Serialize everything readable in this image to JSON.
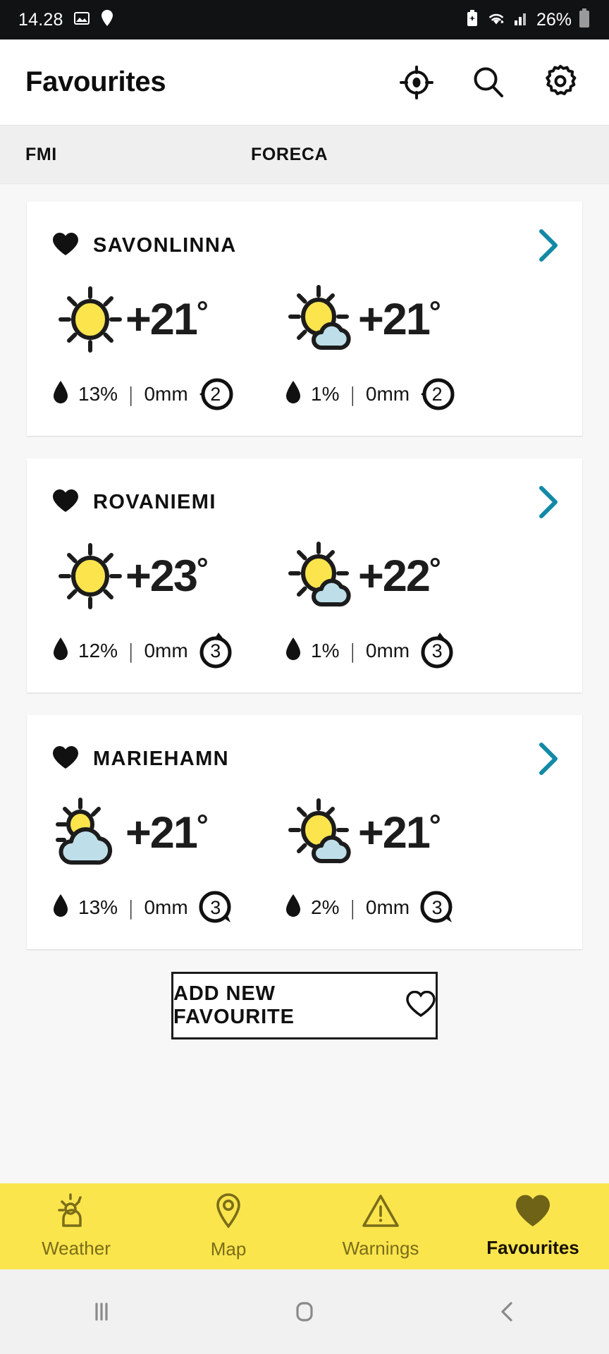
{
  "status_bar": {
    "time": "14.28",
    "battery_percent": "26%",
    "icons": [
      "image-icon",
      "location-pin-icon",
      "battery-saver-icon",
      "wifi-icon",
      "signal-icon",
      "battery-icon"
    ]
  },
  "app_bar": {
    "title": "Favourites",
    "actions": [
      {
        "name": "locate-icon",
        "label": "Locate"
      },
      {
        "name": "search-icon",
        "label": "Search"
      },
      {
        "name": "settings-gear-icon",
        "label": "Settings"
      }
    ]
  },
  "source_header": {
    "col1": "FMI",
    "col2": "FORECA"
  },
  "accent_colors": {
    "chevron_teal": "#1389a6",
    "nav_yellow": "#fbe54d",
    "nav_label": "#7a6d18",
    "nav_active_label": "#171003",
    "sun_yellow": "#fce44d",
    "cloud_blue": "#bedfe9",
    "outline": "#1c1c1c"
  },
  "favourites": [
    {
      "city": "SAVONLINNA",
      "fmi": {
        "icon": "sunny-icon",
        "temperature": "+21",
        "degree": "°",
        "precip_probability": "13%",
        "precip_amount": "0mm",
        "warning_count": "2",
        "badge_tail": "left"
      },
      "foreca": {
        "icon": "partly-sunny-icon",
        "temperature": "+21",
        "degree": "°",
        "precip_probability": "1%",
        "precip_amount": "0mm",
        "warning_count": "2",
        "badge_tail": "left"
      }
    },
    {
      "city": "ROVANIEMI",
      "fmi": {
        "icon": "sunny-icon",
        "temperature": "+23",
        "degree": "°",
        "precip_probability": "12%",
        "precip_amount": "0mm",
        "warning_count": "3",
        "badge_tail": "top"
      },
      "foreca": {
        "icon": "partly-sunny-icon",
        "temperature": "+22",
        "degree": "°",
        "precip_probability": "1%",
        "precip_amount": "0mm",
        "warning_count": "3",
        "badge_tail": "top"
      }
    },
    {
      "city": "MARIEHAMN",
      "fmi": {
        "icon": "mostly-cloudy-icon",
        "temperature": "+21",
        "degree": "°",
        "precip_probability": "13%",
        "precip_amount": "0mm",
        "warning_count": "3",
        "badge_tail": "bottom"
      },
      "foreca": {
        "icon": "partly-sunny-icon",
        "temperature": "+21",
        "degree": "°",
        "precip_probability": "2%",
        "precip_amount": "0mm",
        "warning_count": "3",
        "badge_tail": "bottom"
      }
    }
  ],
  "add_favourite": {
    "label": "ADD NEW FAVOURITE",
    "icon": "heart-outline-icon"
  },
  "bottom_nav": [
    {
      "label": "Weather",
      "icon": "weather-sun-cloud-icon",
      "active": false
    },
    {
      "label": "Map",
      "icon": "map-pin-icon",
      "active": false
    },
    {
      "label": "Warnings",
      "icon": "warning-triangle-icon",
      "active": false
    },
    {
      "label": "Favourites",
      "icon": "heart-filled-icon",
      "active": true
    }
  ],
  "android_nav": [
    {
      "name": "recents-button"
    },
    {
      "name": "home-button"
    },
    {
      "name": "back-button"
    }
  ]
}
